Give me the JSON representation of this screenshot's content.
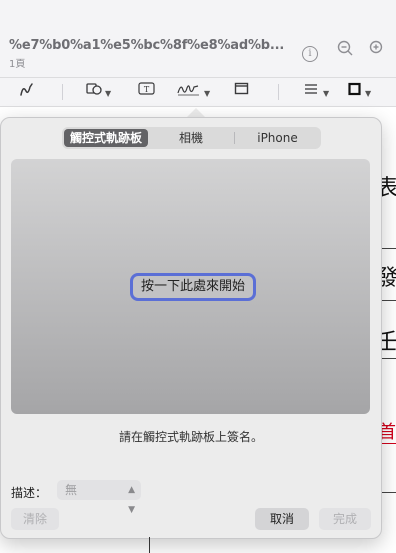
{
  "window": {
    "doc_title": "%e7%b0%a1%e5%bc%8f%e8%ad%b...",
    "page_count": "1頁",
    "info_icon": "ⓘ",
    "zoom_out_icon": "⊖",
    "zoom_in_icon": "⊕"
  },
  "toolbar": {
    "pen_icon": "pen-icon",
    "shapes_icon": "shapes-icon",
    "text_icon": "text-box-icon",
    "sign_icon": "signature-icon",
    "box_icon": "box-icon",
    "lines_icon": "line-style-icon",
    "border_icon": "border-color-icon"
  },
  "document": {
    "char_a": "表",
    "char_b": "發",
    "char_c": "壬",
    "char_d": "首"
  },
  "signature": {
    "tabs": [
      {
        "label": "觸控式軌跡板",
        "active": true
      },
      {
        "label": "相機",
        "active": false
      },
      {
        "label": "iPhone",
        "active": false
      }
    ],
    "start_label": "按一下此處來開始",
    "instruction": "請在觸控式軌跡板上簽名。",
    "description_label": "描述：",
    "description_value": "無",
    "clear_label": "清除",
    "cancel_label": "取消",
    "done_label": "完成"
  },
  "colors": {
    "accent_focus": "#5b6fd6",
    "link_red": "#d0021b"
  }
}
